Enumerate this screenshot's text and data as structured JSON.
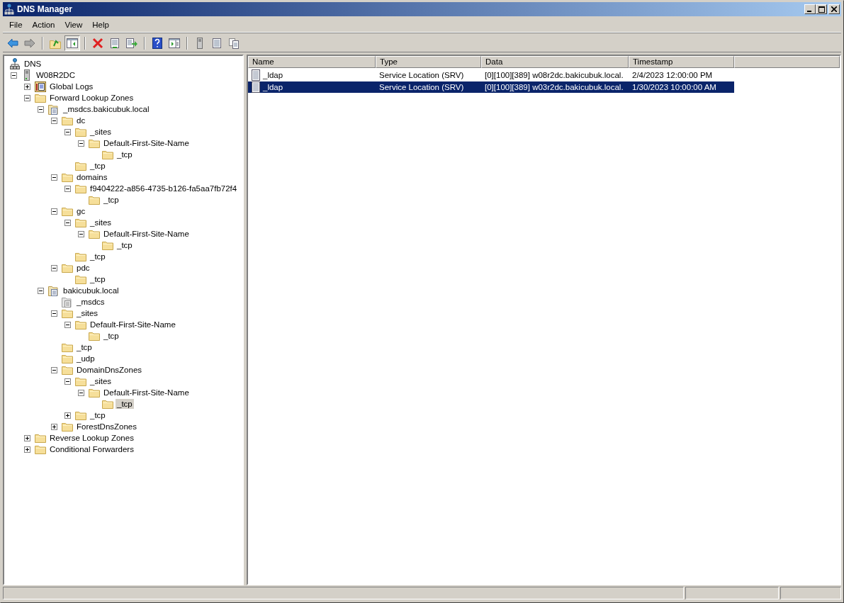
{
  "window": {
    "title": "DNS Manager"
  },
  "menu": [
    "File",
    "Action",
    "View",
    "Help"
  ],
  "toolbar": [
    [
      {
        "kind": "back",
        "pressed": false,
        "disabled": false
      },
      {
        "kind": "forward",
        "pressed": false,
        "disabled": true
      }
    ],
    [
      {
        "kind": "up",
        "pressed": false,
        "disabled": false
      },
      {
        "kind": "tree",
        "pressed": true,
        "disabled": false
      }
    ],
    [
      {
        "kind": "delete",
        "pressed": false,
        "disabled": false
      },
      {
        "kind": "properties",
        "pressed": false,
        "disabled": false
      },
      {
        "kind": "export",
        "pressed": false,
        "disabled": false
      }
    ],
    [
      {
        "kind": "help",
        "pressed": false,
        "disabled": false
      },
      {
        "kind": "actionpane",
        "pressed": false,
        "disabled": false
      }
    ],
    [
      {
        "kind": "server",
        "pressed": false,
        "disabled": false
      },
      {
        "kind": "list",
        "pressed": false,
        "disabled": false
      },
      {
        "kind": "copy",
        "pressed": false,
        "disabled": false
      }
    ]
  ],
  "tree": {
    "label": "DNS",
    "kind": "dns",
    "selected": false,
    "children": [
      {
        "label": "W08R2DC",
        "kind": "server",
        "expanded": true,
        "selected": false,
        "children": [
          {
            "label": "Global Logs",
            "kind": "logs",
            "expanded": false,
            "selected": false
          },
          {
            "label": "Forward Lookup Zones",
            "kind": "folder",
            "expanded": true,
            "selected": false,
            "children": [
              {
                "label": "_msdcs.bakicubuk.local",
                "kind": "zone",
                "expanded": true,
                "selected": false,
                "children": [
                  {
                    "label": "dc",
                    "kind": "folder",
                    "expanded": true,
                    "selected": false,
                    "children": [
                      {
                        "label": "_sites",
                        "kind": "folder",
                        "expanded": true,
                        "selected": false,
                        "children": [
                          {
                            "label": "Default-First-Site-Name",
                            "kind": "folder",
                            "expanded": true,
                            "selected": false,
                            "children": [
                              {
                                "label": "_tcp",
                                "kind": "folder",
                                "selected": false
                              }
                            ]
                          }
                        ]
                      },
                      {
                        "label": "_tcp",
                        "kind": "folder",
                        "selected": false
                      }
                    ]
                  },
                  {
                    "label": "domains",
                    "kind": "folder",
                    "expanded": true,
                    "selected": false,
                    "children": [
                      {
                        "label": "f9404222-a856-4735-b126-fa5aa7fb72f4",
                        "kind": "folder",
                        "expanded": true,
                        "selected": false,
                        "children": [
                          {
                            "label": "_tcp",
                            "kind": "folder",
                            "selected": false
                          }
                        ]
                      }
                    ]
                  },
                  {
                    "label": "gc",
                    "kind": "folder",
                    "expanded": true,
                    "selected": false,
                    "children": [
                      {
                        "label": "_sites",
                        "kind": "folder",
                        "expanded": true,
                        "selected": false,
                        "children": [
                          {
                            "label": "Default-First-Site-Name",
                            "kind": "folder",
                            "expanded": true,
                            "selected": false,
                            "children": [
                              {
                                "label": "_tcp",
                                "kind": "folder",
                                "selected": false
                              }
                            ]
                          }
                        ]
                      },
                      {
                        "label": "_tcp",
                        "kind": "folder",
                        "selected": false
                      }
                    ]
                  },
                  {
                    "label": "pdc",
                    "kind": "folder",
                    "expanded": true,
                    "selected": false,
                    "children": [
                      {
                        "label": "_tcp",
                        "kind": "folder",
                        "selected": false
                      }
                    ]
                  }
                ]
              },
              {
                "label": "bakicubuk.local",
                "kind": "zone",
                "expanded": true,
                "selected": false,
                "children": [
                  {
                    "label": "_msdcs",
                    "kind": "delegation",
                    "selected": false
                  },
                  {
                    "label": "_sites",
                    "kind": "folder",
                    "expanded": true,
                    "selected": false,
                    "children": [
                      {
                        "label": "Default-First-Site-Name",
                        "kind": "folder",
                        "expanded": true,
                        "selected": false,
                        "children": [
                          {
                            "label": "_tcp",
                            "kind": "folder",
                            "selected": false
                          }
                        ]
                      }
                    ]
                  },
                  {
                    "label": "_tcp",
                    "kind": "folder",
                    "selected": false
                  },
                  {
                    "label": "_udp",
                    "kind": "folder",
                    "selected": false
                  },
                  {
                    "label": "DomainDnsZones",
                    "kind": "folder",
                    "expanded": true,
                    "selected": false,
                    "children": [
                      {
                        "label": "_sites",
                        "kind": "folder",
                        "expanded": true,
                        "selected": false,
                        "children": [
                          {
                            "label": "Default-First-Site-Name",
                            "kind": "folder",
                            "expanded": true,
                            "selected": false,
                            "children": [
                              {
                                "label": "_tcp",
                                "kind": "folder",
                                "selected": true
                              }
                            ]
                          }
                        ]
                      },
                      {
                        "label": "_tcp",
                        "kind": "folder",
                        "expanded": false,
                        "selected": false
                      }
                    ]
                  },
                  {
                    "label": "ForestDnsZones",
                    "kind": "folder",
                    "expanded": false,
                    "selected": false
                  }
                ]
              }
            ]
          },
          {
            "label": "Reverse Lookup Zones",
            "kind": "folder",
            "expanded": false,
            "selected": false
          },
          {
            "label": "Conditional Forwarders",
            "kind": "folder",
            "expanded": false,
            "selected": false
          }
        ]
      }
    ]
  },
  "list": {
    "columns": [
      "Name",
      "Type",
      "Data",
      "Timestamp"
    ],
    "rows": [
      {
        "cells": [
          "_ldap",
          "Service Location (SRV)",
          "[0][100][389] w08r2dc.bakicubuk.local.",
          "2/4/2023 12:00:00 PM"
        ],
        "selected": false
      },
      {
        "cells": [
          "_ldap",
          "Service Location (SRV)",
          "[0][100][389] w03r2dc.bakicubuk.local.",
          "1/30/2023 10:00:00 AM"
        ],
        "selected": true
      }
    ]
  }
}
